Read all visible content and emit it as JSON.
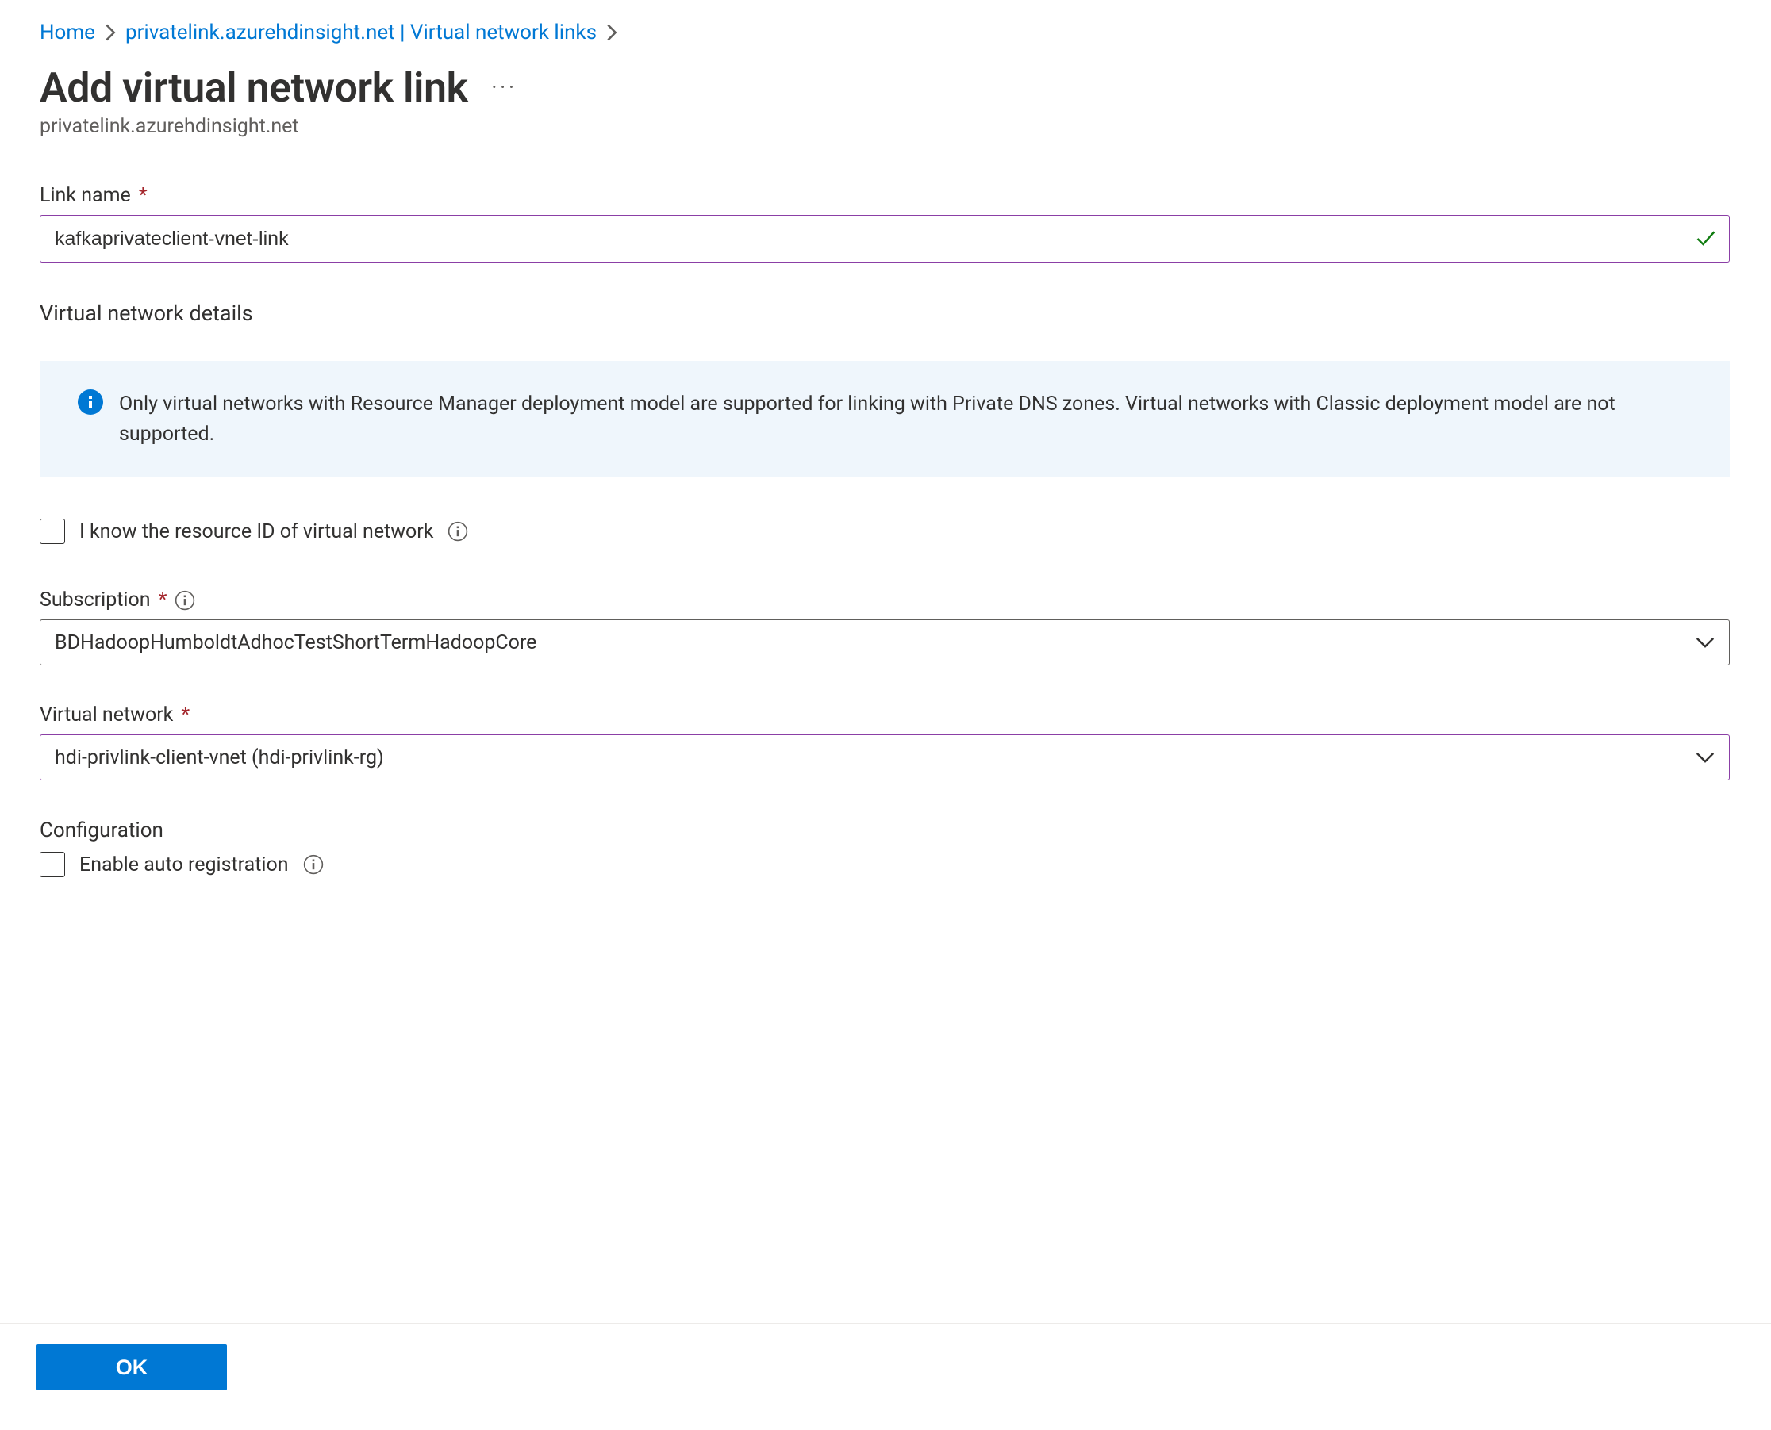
{
  "breadcrumb": {
    "home": "Home",
    "zone": "privatelink.azurehdinsight.net | Virtual network links"
  },
  "header": {
    "title": "Add virtual network link",
    "subtitle": "privatelink.azurehdinsight.net"
  },
  "form": {
    "link_name_label": "Link name",
    "link_name_value": "kafkaprivateclient-vnet-link",
    "vnet_details_heading": "Virtual network details",
    "info_text": "Only virtual networks with Resource Manager deployment model are supported for linking with Private DNS zones. Virtual networks with Classic deployment model are not supported.",
    "know_resource_id_label": "I know the resource ID of virtual network",
    "subscription_label": "Subscription",
    "subscription_value": "BDHadoopHumboldtAdhocTestShortTermHadoopCore",
    "vnet_label": "Virtual network",
    "vnet_value": "hdi-privlink-client-vnet (hdi-privlink-rg)",
    "config_heading": "Configuration",
    "auto_reg_label": "Enable auto registration"
  },
  "footer": {
    "ok_label": "OK"
  }
}
